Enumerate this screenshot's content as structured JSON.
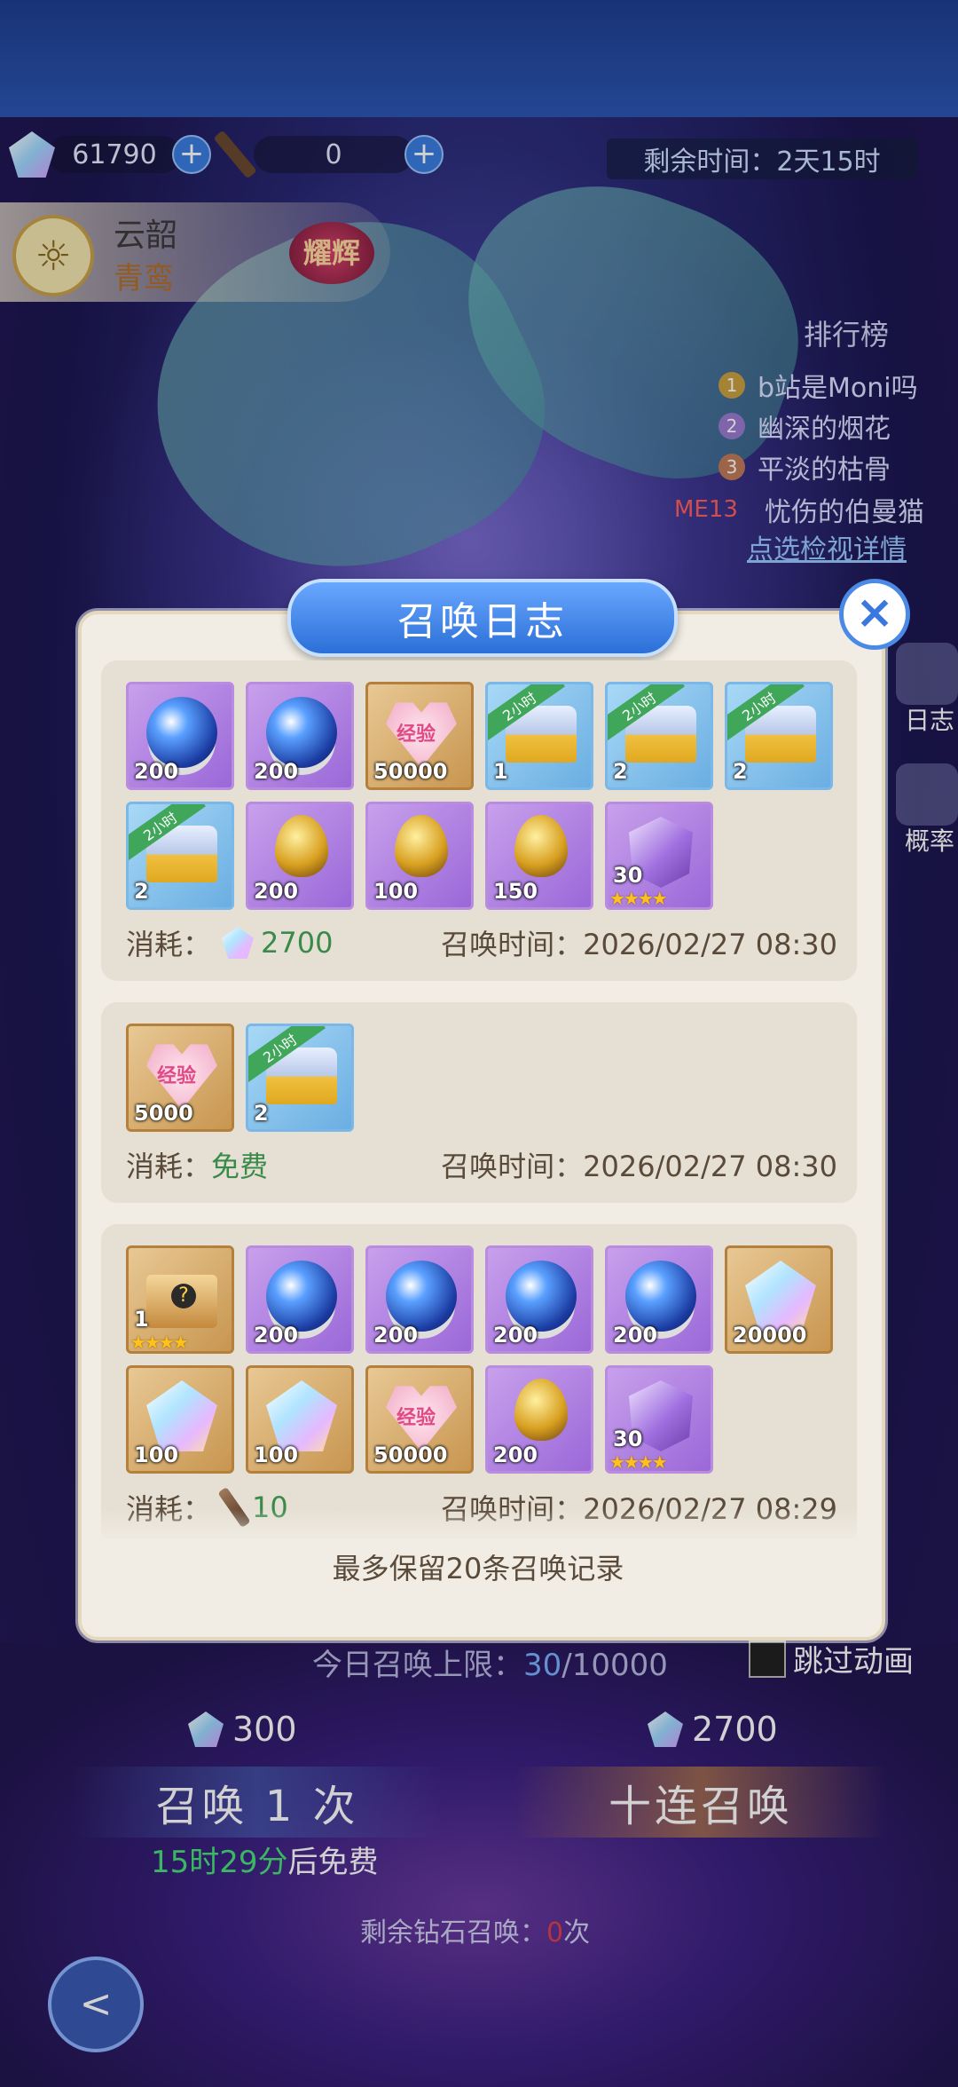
{
  "resources": {
    "gems": "61790",
    "rods": "0"
  },
  "event_timer": "剩余时间：2天15时",
  "character": {
    "name": "云韶",
    "subtitle": "青鸾",
    "badge": "耀辉"
  },
  "ranking": {
    "title": "排行榜",
    "entries": [
      {
        "rank": "1",
        "name": "b站是Moni吗"
      },
      {
        "rank": "2",
        "name": "幽深的烟花"
      },
      {
        "rank": "3",
        "name": "平淡的枯骨"
      },
      {
        "rank": "ME13",
        "name": "忧伤的伯曼猫"
      }
    ],
    "detail_link": "点选检视详情"
  },
  "side_labels": {
    "log": "日志",
    "rate": "概率"
  },
  "dialog": {
    "title": "召唤日志",
    "footer": "最多保留20条召唤记录",
    "time_label": "召唤时间：",
    "cost_label": "消耗：",
    "records": [
      {
        "items": [
          {
            "icon": "blue-orb-icon",
            "bg": "purple",
            "qty": "200"
          },
          {
            "icon": "blue-orb-icon",
            "bg": "purple",
            "qty": "200"
          },
          {
            "icon": "exp-heart-icon",
            "bg": "gold",
            "qty": "50000",
            "label": "经验"
          },
          {
            "icon": "treasure-chest-icon",
            "bg": "blue",
            "qty": "1",
            "ribbon": "2小时"
          },
          {
            "icon": "treasure-chest-icon",
            "bg": "blue",
            "qty": "2",
            "ribbon": "2小时"
          },
          {
            "icon": "treasure-chest-icon",
            "bg": "blue",
            "qty": "2",
            "ribbon": "2小时"
          },
          {
            "icon": "treasure-chest-icon",
            "bg": "blue",
            "qty": "2",
            "ribbon": "2小时"
          },
          {
            "icon": "golden-egg-icon",
            "bg": "purple",
            "qty": "200"
          },
          {
            "icon": "golden-egg-icon",
            "bg": "purple",
            "qty": "100"
          },
          {
            "icon": "golden-egg-icon",
            "bg": "purple",
            "qty": "150"
          },
          {
            "icon": "purple-crystal-icon",
            "bg": "purple",
            "qty": "30",
            "stars": "★★★★"
          }
        ],
        "cost_type": "gem",
        "cost": "2700",
        "time": "2026/02/27 08:30"
      },
      {
        "items": [
          {
            "icon": "exp-heart-icon",
            "bg": "gold",
            "qty": "5000",
            "label": "经验"
          },
          {
            "icon": "treasure-chest-icon",
            "bg": "blue",
            "qty": "2",
            "ribbon": "2小时"
          }
        ],
        "cost_type": "free",
        "cost": "免费",
        "time": "2026/02/27 08:30"
      },
      {
        "items": [
          {
            "icon": "mystery-box-icon",
            "bg": "gold",
            "qty": "1",
            "stars": "★★★★"
          },
          {
            "icon": "blue-orb-icon",
            "bg": "purple",
            "qty": "200"
          },
          {
            "icon": "blue-orb-icon",
            "bg": "purple",
            "qty": "200"
          },
          {
            "icon": "blue-orb-icon",
            "bg": "purple",
            "qty": "200"
          },
          {
            "icon": "blue-orb-icon",
            "bg": "purple",
            "qty": "200"
          },
          {
            "icon": "rainbow-gem-icon",
            "bg": "gold",
            "qty": "20000"
          },
          {
            "icon": "rainbow-gem-icon",
            "bg": "gold",
            "qty": "100"
          },
          {
            "icon": "rainbow-gem-icon",
            "bg": "gold",
            "qty": "100"
          },
          {
            "icon": "exp-heart-icon",
            "bg": "gold",
            "qty": "50000",
            "label": "经验"
          },
          {
            "icon": "golden-egg-icon",
            "bg": "purple",
            "qty": "200"
          },
          {
            "icon": "purple-crystal-icon",
            "bg": "purple",
            "qty": "30",
            "stars": "★★★★"
          }
        ],
        "cost_type": "rod",
        "cost": "10",
        "time": "2026/02/27 08:29"
      },
      {
        "items": [
          {
            "icon": "mystery-box-icon",
            "bg": "gold",
            "qty": ""
          },
          {
            "icon": "mystery-box-icon",
            "bg": "red",
            "qty": ""
          },
          {
            "icon": "blue-orb-icon",
            "bg": "purple",
            "qty": ""
          },
          {
            "icon": "blue-orb-icon",
            "bg": "purple",
            "qty": ""
          },
          {
            "icon": "blue-orb-icon",
            "bg": "purple",
            "qty": ""
          },
          {
            "icon": "rainbow-gem-icon",
            "bg": "gold",
            "qty": ""
          }
        ],
        "cost_type": "",
        "cost": "",
        "time": ""
      }
    ]
  },
  "summon": {
    "today_limit_label": "今日召唤上限：",
    "today_current": "30",
    "today_max": "/10000",
    "skip_animation": "跳过动画",
    "single_cost": "300",
    "ten_cost": "2700",
    "single_label": "召唤 1 次",
    "ten_label": "十连召唤",
    "free_time": "15时29分",
    "free_suffix": "后免费",
    "remaining_label": "剩余钻石召唤：",
    "remaining_count": "0",
    "remaining_suffix": "次"
  },
  "colors": {
    "dialog_title_bg": "#2b6fd8",
    "purple_tile": "#9a68d8",
    "gold_tile": "#c89650",
    "blue_tile": "#6aaee2",
    "free_green": "#3a8a4a"
  }
}
